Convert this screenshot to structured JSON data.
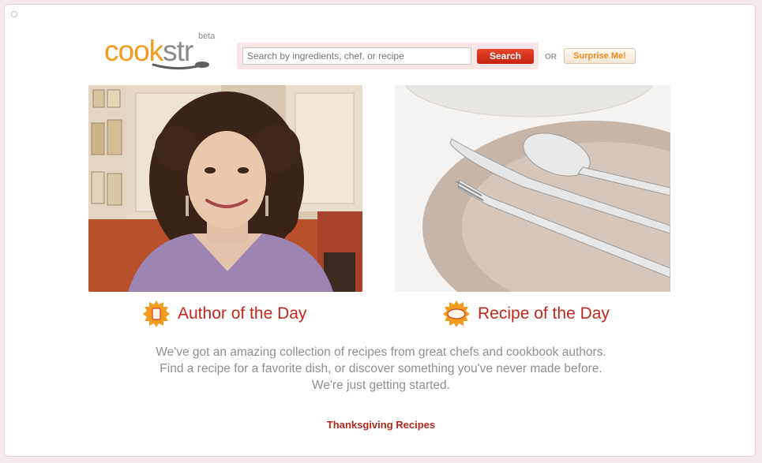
{
  "logo": {
    "word_a": "cook",
    "word_b": "str",
    "badge": "beta"
  },
  "search": {
    "placeholder": "Search by ingredients, chef, or recipe",
    "button_label": "Search",
    "or_label": "OR",
    "surprise_label": "Surprise Me!"
  },
  "features": [
    {
      "label": "Author of the Day",
      "icon": "can-icon"
    },
    {
      "label": "Recipe of the Day",
      "icon": "plate-icon"
    }
  ],
  "tagline": [
    "We've got an amazing collection of recipes from great chefs and cookbook authors.",
    "Find a recipe for a favorite dish, or discover something you've never made before.",
    "We're just getting started."
  ],
  "promo_link": "Thanksgiving Recipes",
  "colors": {
    "brand_orange": "#f39b1e",
    "link_red": "#c0281c",
    "search_button": "#d9331c"
  }
}
